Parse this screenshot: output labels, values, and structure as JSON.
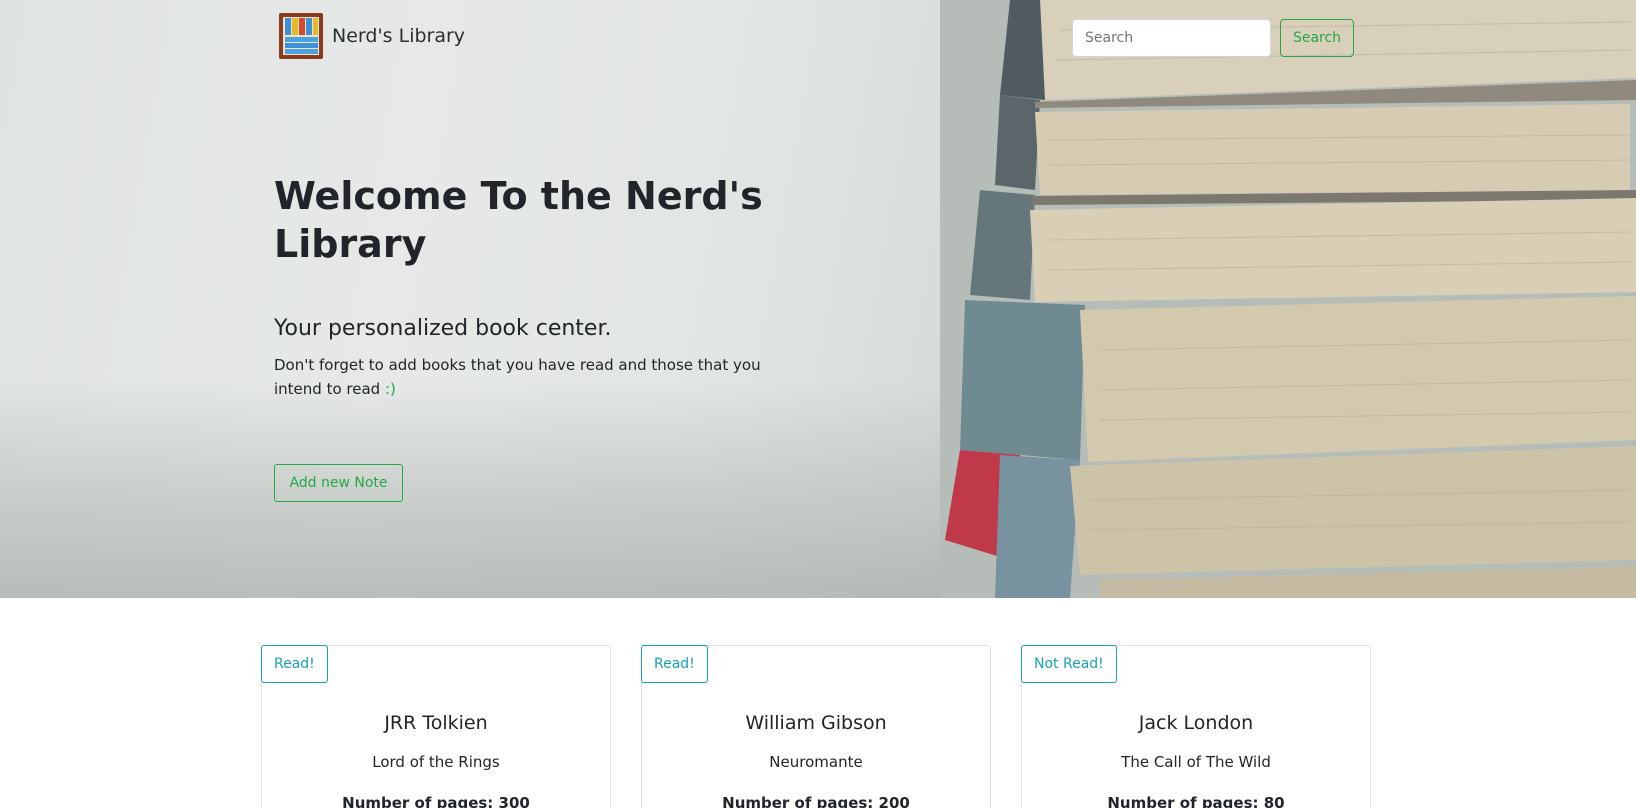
{
  "brand": {
    "name": "Nerd's Library",
    "logo_icon": "bookshelf-icon"
  },
  "search": {
    "placeholder": "Search",
    "value": "",
    "button_label": "Search"
  },
  "hero": {
    "title": "Welcome To the Nerd's Library",
    "subtitle": "Your personalized book center.",
    "description": "Don't forget to add books that you have read and those that you intend to read",
    "smiley": ":)",
    "add_button_label": "Add new Note"
  },
  "books": [
    {
      "status": "Read!",
      "author": "JRR Tolkien",
      "title": "Lord of the Rings",
      "pages_label": "Number of pages: 300"
    },
    {
      "status": "Read!",
      "author": "William Gibson",
      "title": "Neuromante",
      "pages_label": "Number of pages: 200"
    },
    {
      "status": "Not Read!",
      "author": "Jack London",
      "title": "The Call of The Wild",
      "pages_label": "Number of pages: 80"
    }
  ],
  "colors": {
    "accent_green": "#28a745",
    "badge_teal": "#17a2b8",
    "text": "#212529"
  }
}
